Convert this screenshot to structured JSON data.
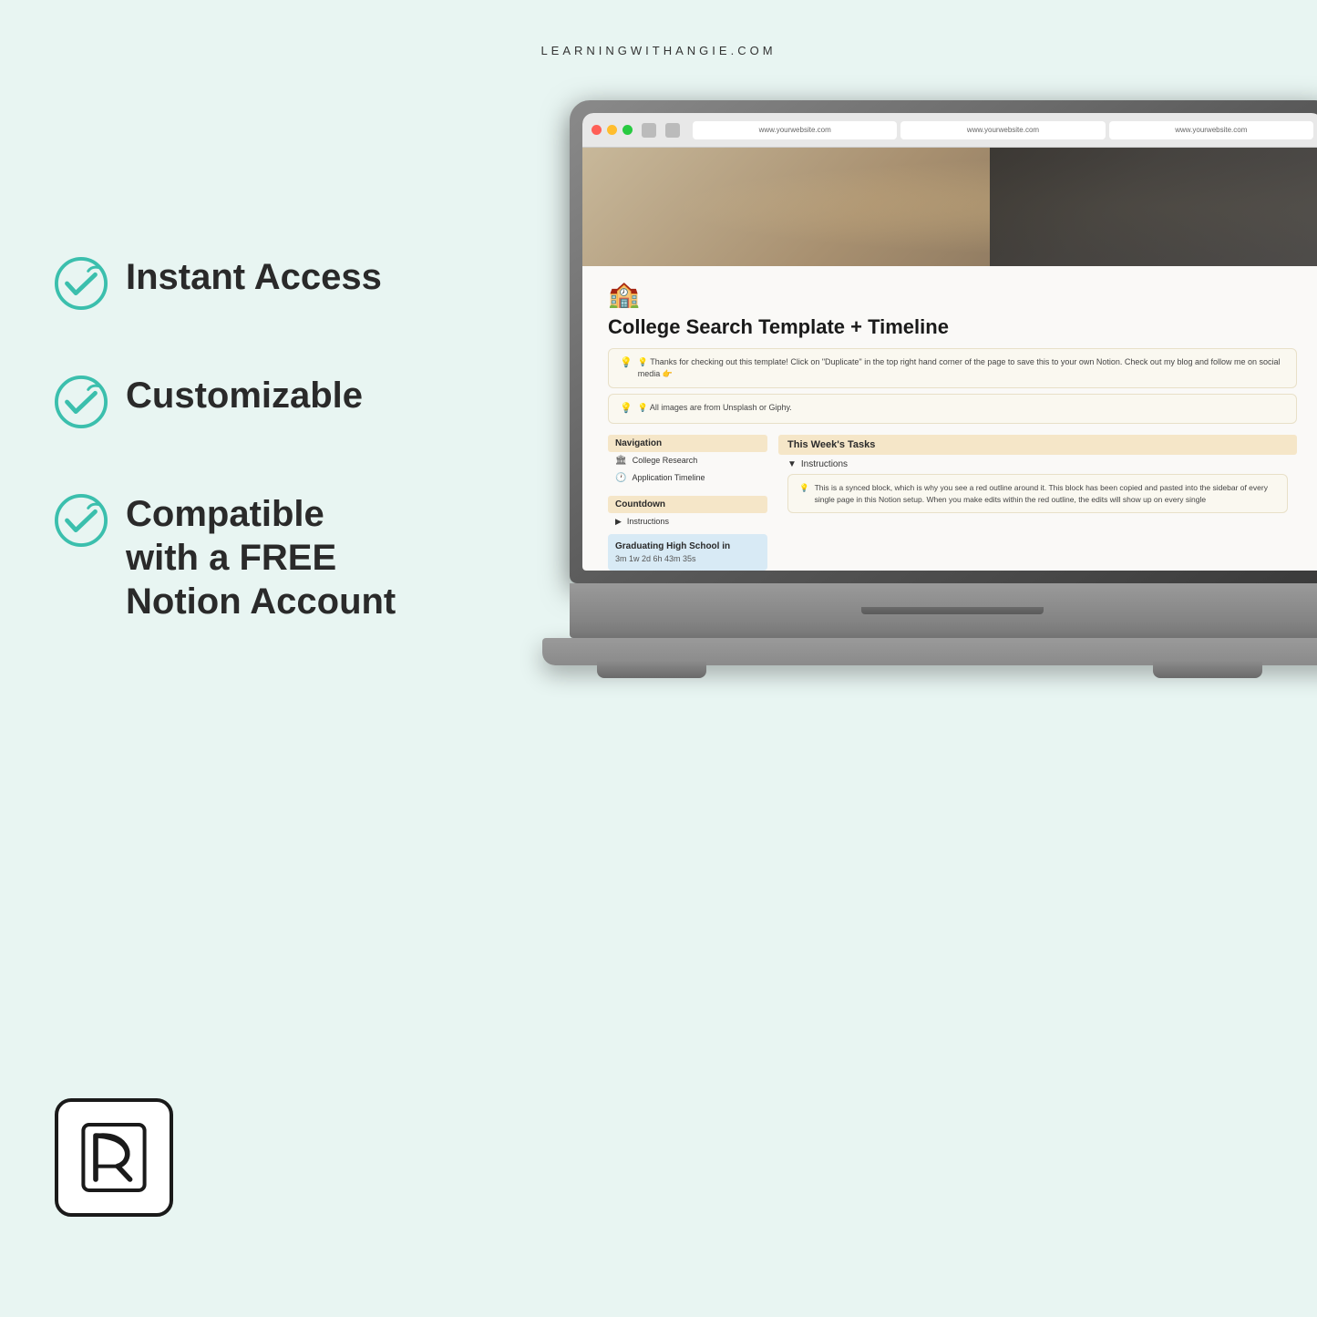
{
  "header": {
    "website": "LEARNINGWITHANGIE.COM"
  },
  "features": [
    {
      "id": "instant-access",
      "text": "Instant Access"
    },
    {
      "id": "customizable",
      "text": "Customizable"
    },
    {
      "id": "compatible",
      "text": "Compatible\nwith a FREE\nNotion Account"
    }
  ],
  "browser": {
    "url1": "www.yourwebsite.com",
    "url2": "www.yourwebsite.com",
    "url3": "www.yourwebsite.com"
  },
  "notion": {
    "title": "College Search Template + Timeline",
    "callout1": "💡 Thanks for checking out this template! Click on \"Duplicate\" in the top right hand corner of the page to save this to your own Notion. Check out my blog and follow me on social media 👉",
    "callout2": "💡 All images are from Unsplash or Giphy.",
    "navigation_heading": "Navigation",
    "nav_items": [
      {
        "icon": "🏛",
        "text": "College Research"
      },
      {
        "icon": "🕐",
        "text": "Application Timeline"
      }
    ],
    "countdown_heading": "Countdown",
    "countdown_toggle": "Instructions",
    "countdown_title": "Graduating High School in",
    "countdown_time": "3m 1w 2d 6h 43m 35s",
    "tasks_heading": "This Week's Tasks",
    "tasks_toggle": "Instructions",
    "tasks_text": "This is a synced block, which is why you see a red outline around it. This block has been copied and pasted into the sidebar of every single page in this Notion setup. When you make edits within the red outline, the edits will show up on every single"
  },
  "colors": {
    "background": "#e8f5f2",
    "teal": "#3bbfad",
    "accent_bg": "#f5e6c8",
    "countdown_bg": "#d8eaf5"
  }
}
